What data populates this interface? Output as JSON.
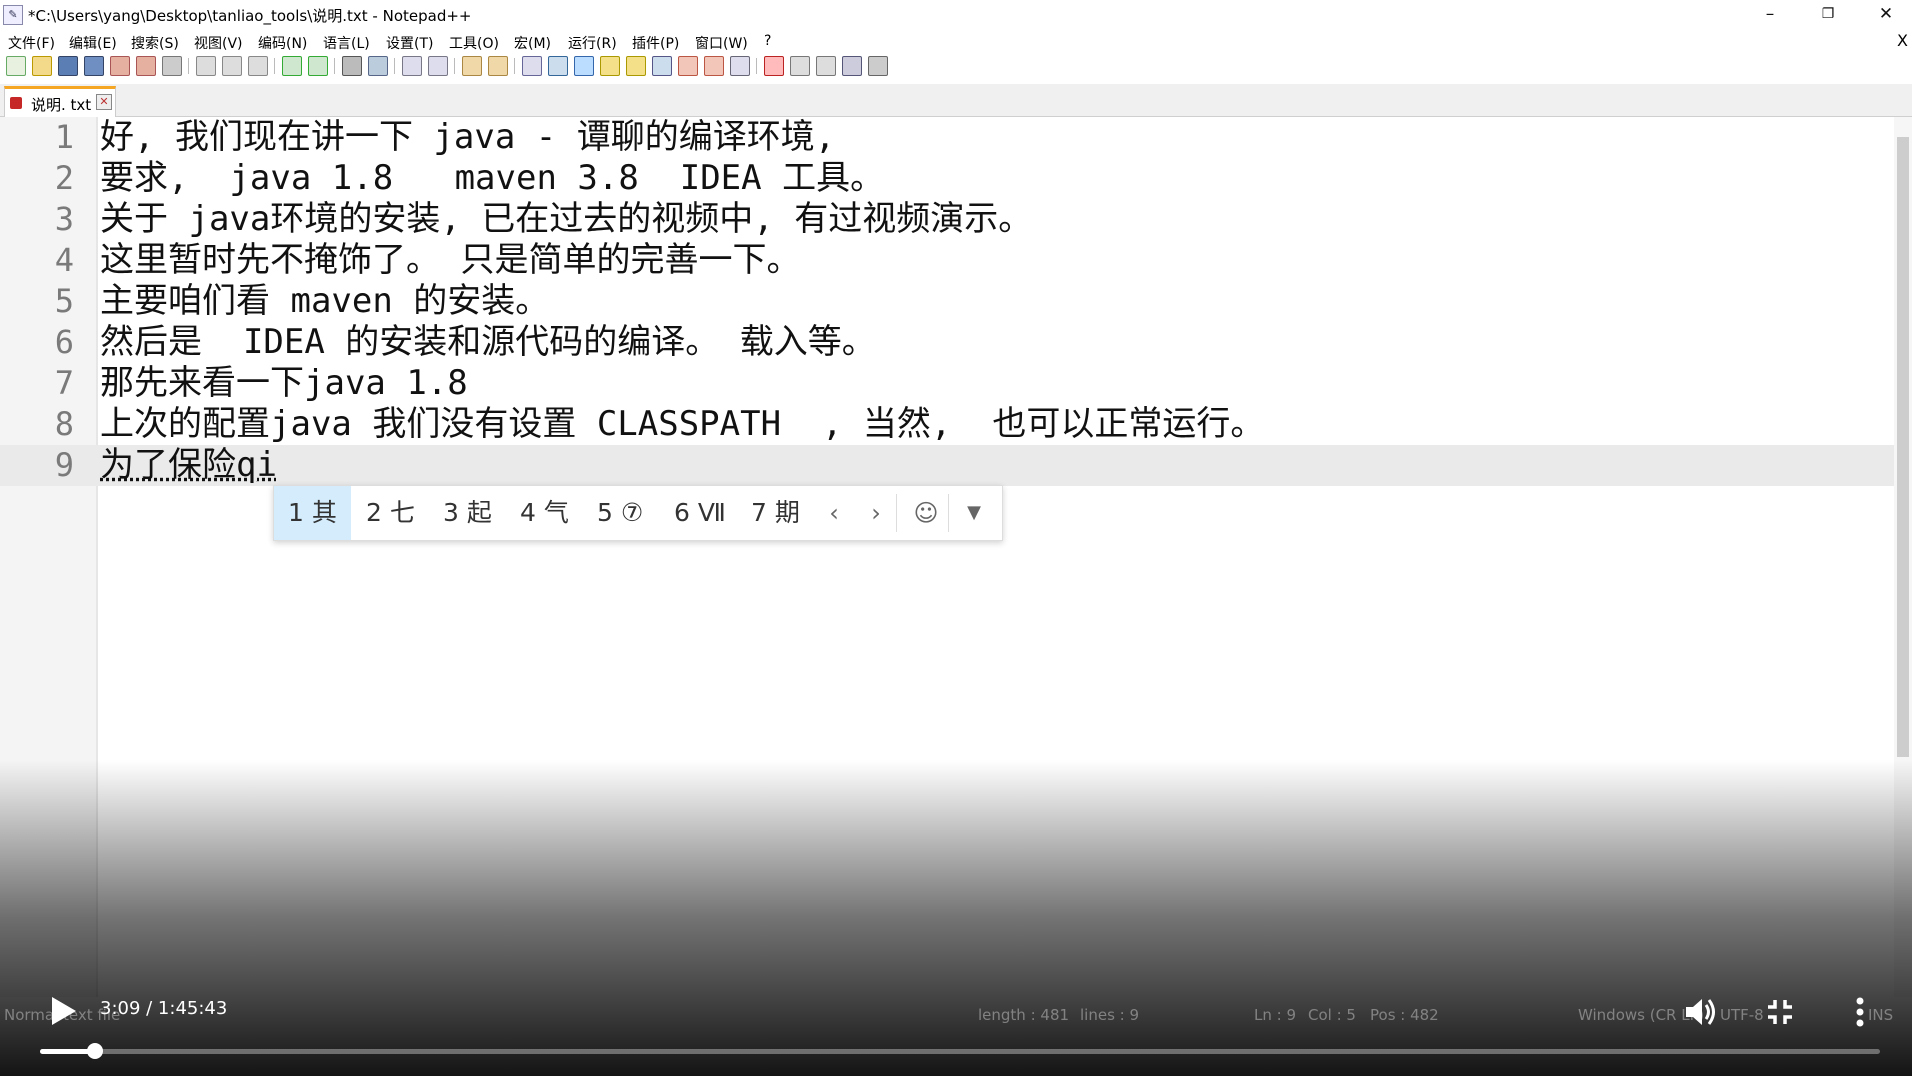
{
  "window": {
    "title": "*C:\\Users\\yang\\Desktop\\tanliao_tools\\说明.txt - Notepad++",
    "minimize": "–",
    "restore": "❐",
    "close": "✕",
    "doc_close": "X"
  },
  "menu": [
    "文件(F)",
    "编辑(E)",
    "搜索(S)",
    "视图(V)",
    "编码(N)",
    "语言(L)",
    "设置(T)",
    "工具(O)",
    "宏(M)",
    "运行(R)",
    "插件(P)",
    "窗口(W)",
    "?"
  ],
  "tab": {
    "label": "说明. txt"
  },
  "editor": {
    "lines": [
      {
        "num": "1",
        "text": "好, 我们现在讲一下 java - 谭聊的编译环境,"
      },
      {
        "num": "2",
        "text": "要求,  java 1.8   maven 3.8  IDEA 工具。"
      },
      {
        "num": "3",
        "text": "关于 java环境的安装, 已在过去的视频中, 有过视频演示。"
      },
      {
        "num": "4",
        "text": "这里暂时先不掩饰了。 只是简单的完善一下。"
      },
      {
        "num": "5",
        "text": "主要咱们看 maven 的安装。"
      },
      {
        "num": "6",
        "text": "然后是  IDEA 的安装和源代码的编译。 载入等。"
      },
      {
        "num": "7",
        "text": "那先来看一下java 1.8"
      },
      {
        "num": "8",
        "text": "上次的配置java 我们没有设置 CLASSPATH  , 当然,  也可以正常运行。"
      },
      {
        "num": "9",
        "text": "为了保险qi"
      }
    ],
    "current_line": 9
  },
  "ime": {
    "candidates": [
      "1 其",
      "2 七",
      "3 起",
      "4 气",
      "5 ⑦",
      "6 Ⅶ",
      "7 期"
    ],
    "prev": "‹",
    "next": "›",
    "emoji": "☺",
    "more": "▼"
  },
  "statusbar": {
    "mode": "Normal text file",
    "length": "length : 481",
    "lines": "lines : 9",
    "ln": "Ln : 9",
    "col": "Col : 5",
    "pos": "Pos : 482",
    "eol": "Windows (CR LF)",
    "encoding": "UTF-8",
    "ins": "INS"
  },
  "player": {
    "time": "3:09 / 1:45:43",
    "progress": 0.0298
  }
}
